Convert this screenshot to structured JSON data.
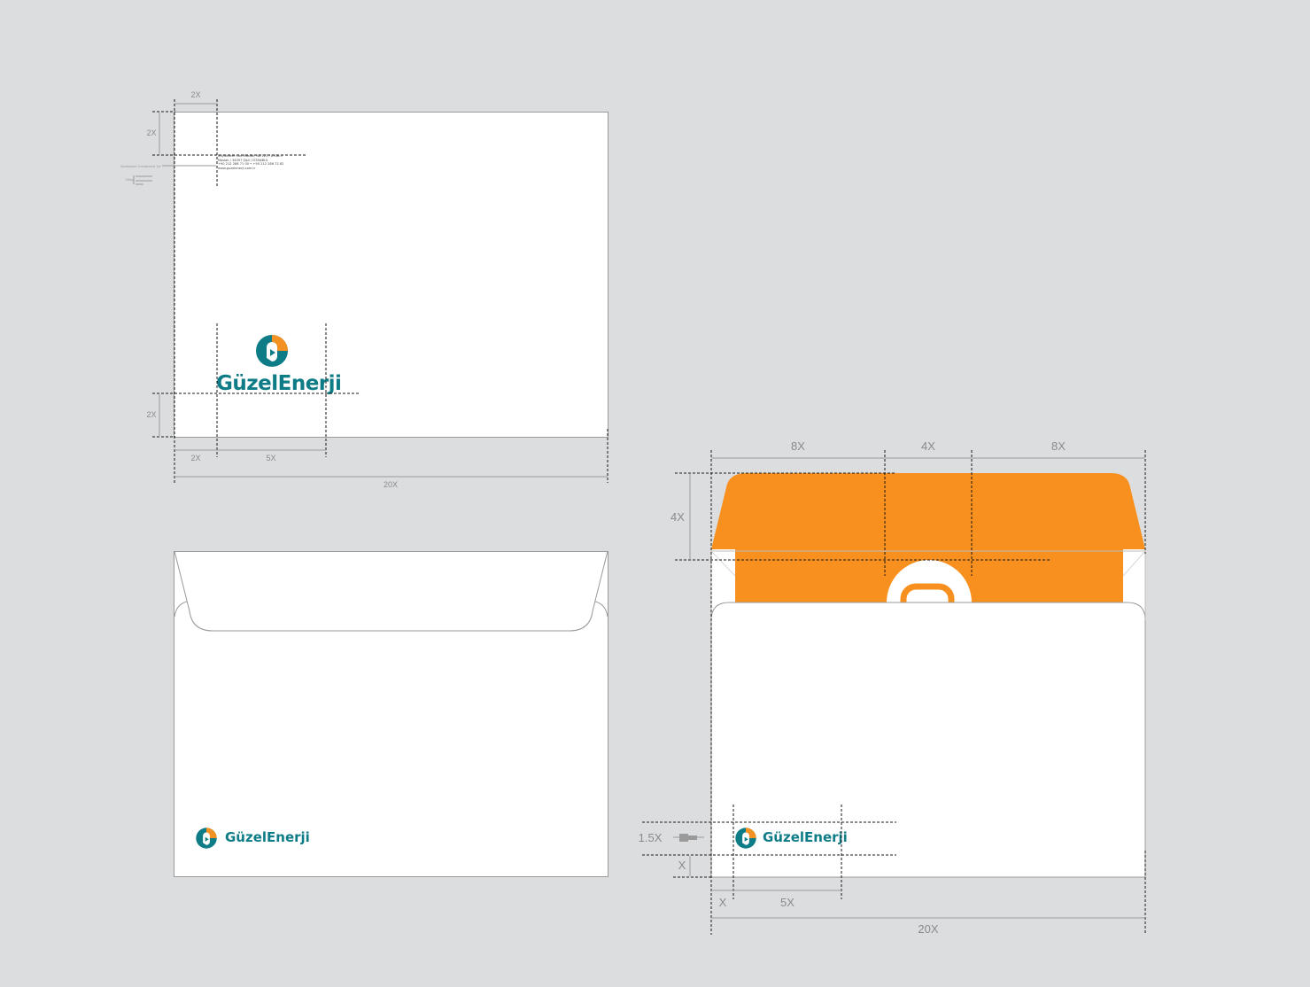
{
  "brand": {
    "name": "GüzelEnerji",
    "teal": "#0e7c86",
    "orange": "#f39223"
  },
  "colors": {
    "background": "#dcdddf",
    "envelope_inner": "#f7901e",
    "guide_line": "#1a1a1a",
    "dimension_text": "#8a8a8a"
  },
  "top_envelope": {
    "address_lines": [
      "Büyükdere Cad.Maslak, No:123 / A Kat:5",
      "Maslak / 34397 Şişli / İSTANBUL",
      "+90 212 286 71 00 • +90 212 286 72 82",
      "www.guzelenerji.com.tr"
    ],
    "side_notes": [
      "Neutraface Condensed 7pt",
      "Nbsp"
    ],
    "labels": {
      "top_margin": "2X",
      "left_top_margin": "2X",
      "bottom_margin": "2X",
      "left_margin": "2X",
      "logo_width": "5X",
      "total_width": "20X"
    }
  },
  "open_envelope": {
    "labels": {
      "flap_left": "8X",
      "flap_center": "4X",
      "flap_right": "8X",
      "flap_height": "4X",
      "logo_height": "1.5X",
      "bottom_margin": "X",
      "left_margin": "X",
      "logo_width": "5X",
      "total_width": "20X"
    }
  },
  "icons": [
    "guzelenerji-logo-icon",
    "line-style-icon",
    "text-style-icon"
  ]
}
